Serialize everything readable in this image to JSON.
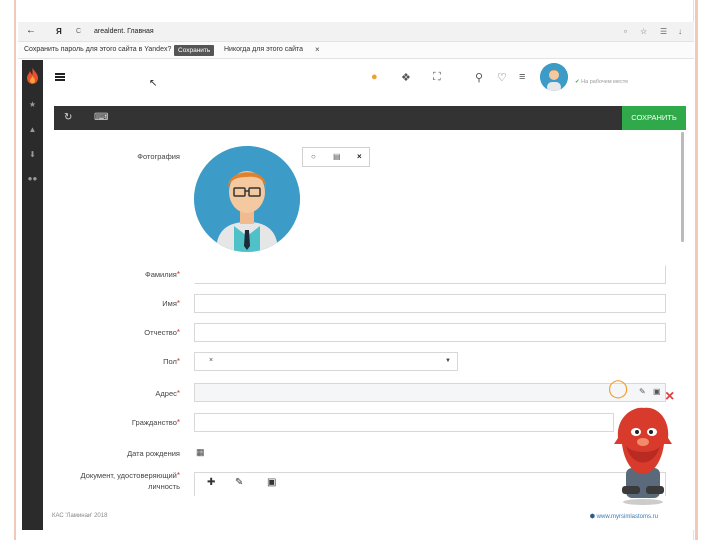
{
  "browser": {
    "tab": {
      "logo": "Я",
      "crumb": "C",
      "title": "arealdent. Главная"
    },
    "password_bar": {
      "prompt": "Сохранить пароль для этого сайта в Yandex?",
      "save_label": "Сохранить",
      "never_label": "Никогда для этого сайта"
    }
  },
  "sidebar": {
    "icons": [
      "flame-logo-icon",
      "star-icon",
      "cap-icon",
      "download-icon",
      "group-icon"
    ]
  },
  "topbar": {
    "status_text": "На рабочем месте"
  },
  "toolbar": {
    "save_label": "СОХРАНИТЬ"
  },
  "form": {
    "labels": {
      "photo": "Фотография",
      "surname": "Фамилия",
      "name": "Имя",
      "patronymic": "Отчество",
      "sex": "Пол",
      "address": "Адрес",
      "citizenship": "Гражданство",
      "birthdate": "Дата рождения",
      "document_line1": "Документ, удостоверяющий",
      "document_line2": "личность"
    },
    "sex_value": "×"
  },
  "footer": {
    "left": "КАС 'Ламинаи' 2018",
    "right": "www.myrsimlastoms.ru"
  },
  "colors": {
    "accent_green": "#2fa94a",
    "toolbar_dark": "#333333",
    "sidebar_dark": "#2b2b2b",
    "avatar_blue": "#3d9cc7"
  }
}
